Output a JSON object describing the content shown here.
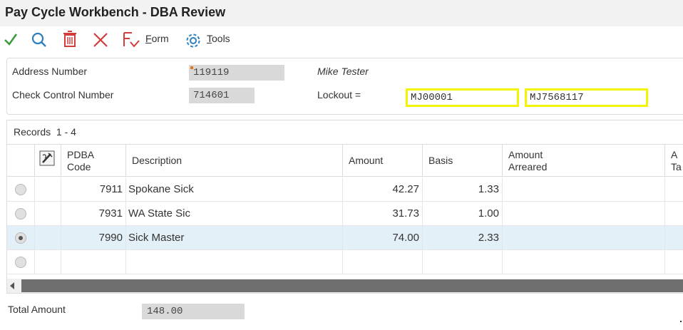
{
  "window": {
    "title": "Pay Cycle Workbench - DBA Review"
  },
  "toolbar": {
    "ok_icon": "checkmark-icon",
    "find_icon": "search-icon",
    "delete_icon": "trash-icon",
    "cancel_icon": "close-icon",
    "form_icon": "form-menu-icon",
    "form_label_accel": "F",
    "form_label_rest": "orm",
    "tools_icon": "gear-icon",
    "tools_label_accel": "T",
    "tools_label_rest": "ools"
  },
  "header": {
    "address_number_label": "Address Number",
    "address_number_value": "119119",
    "name_value": "Mike Tester",
    "check_control_label": "Check Control Number",
    "check_control_value": "714601",
    "lockout_label": "Lockout =",
    "lockout_value_1": "MJ00001",
    "lockout_value_2": "MJ7568117"
  },
  "grid": {
    "records_label": "Records",
    "records_range": "1 - 4",
    "columns": {
      "pdba_code": [
        "PDBA",
        "Code"
      ],
      "description": "Description",
      "amount": "Amount",
      "basis": "Basis",
      "amount_arreared": [
        "Amount",
        "Arreared"
      ],
      "next_partial": [
        "A",
        "Ta"
      ]
    },
    "rows": [
      {
        "code": "7911",
        "description": "Spokane Sick",
        "amount": "42.27",
        "basis": "1.33",
        "selected": false
      },
      {
        "code": "7931",
        "description": "WA State Sic",
        "amount": "31.73",
        "basis": "1.00",
        "selected": false
      },
      {
        "code": "7990",
        "description": "Sick Master",
        "amount": "74.00",
        "basis": "2.33",
        "selected": true
      },
      {
        "code": "",
        "description": "",
        "amount": "",
        "basis": "",
        "selected": false
      }
    ]
  },
  "footer": {
    "total_amount_label": "Total Amount",
    "total_amount_value": "148.00"
  },
  "colors": {
    "lockout_border": "#f4f400",
    "readonly_bg": "#d9d9d9",
    "selected_row": "#e4f0f8"
  }
}
